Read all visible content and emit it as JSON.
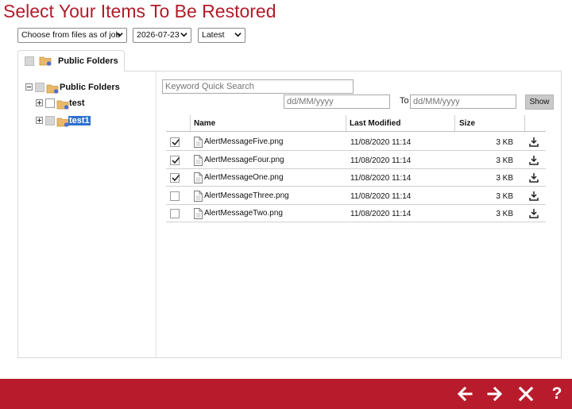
{
  "page": {
    "title": "Select Your Items To Be Restored"
  },
  "filters": {
    "job_select": "Choose from files as of job",
    "date_select": "2026-07-23",
    "version_select": "Latest"
  },
  "tab": {
    "label": "Public Folders"
  },
  "tree": {
    "root": {
      "label": "Public Folders"
    },
    "children": [
      {
        "label": "test",
        "selected": false
      },
      {
        "label": "test1",
        "selected": true
      }
    ]
  },
  "search": {
    "keyword_placeholder": "Keyword Quick Search",
    "from_placeholder": "dd/MM/yyyy",
    "to_label": "To",
    "to_placeholder": "dd/MM/yyyy",
    "show_label": "Show"
  },
  "table": {
    "columns": {
      "name": "Name",
      "modified": "Last Modified",
      "size": "Size"
    },
    "rows": [
      {
        "name": "AlertMessageFive.png",
        "modified": "11/08/2020 11:14",
        "size": "3 KB",
        "checked": true
      },
      {
        "name": "AlertMessageFour.png",
        "modified": "11/08/2020 11:14",
        "size": "3 KB",
        "checked": true
      },
      {
        "name": "AlertMessageOne.png",
        "modified": "11/08/2020 11:14",
        "size": "3 KB",
        "checked": true
      },
      {
        "name": "AlertMessageThree.png",
        "modified": "11/08/2020 11:14",
        "size": "3 KB",
        "checked": false
      },
      {
        "name": "AlertMessageTwo.png",
        "modified": "11/08/2020 11:14",
        "size": "3 KB",
        "checked": false
      }
    ]
  },
  "footer": {
    "icons": [
      "back-arrow-icon",
      "forward-arrow-icon",
      "close-icon",
      "help-icon"
    ],
    "help_label": "?"
  },
  "colors": {
    "brand_red": "#b81c2c",
    "title_red": "#b31b2a",
    "selection_blue": "#2f6fd1"
  }
}
